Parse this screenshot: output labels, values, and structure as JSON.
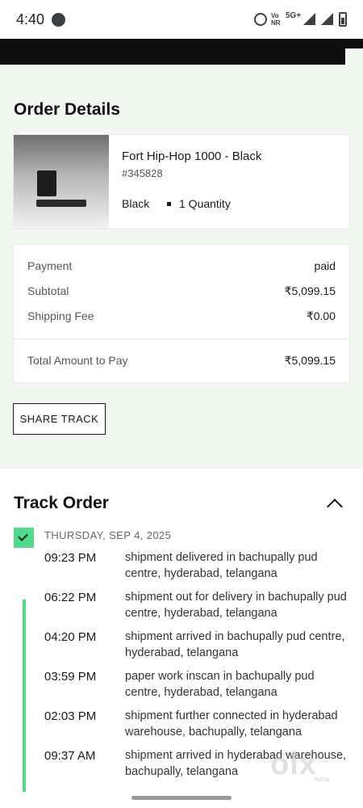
{
  "status_bar": {
    "time": "4:40",
    "network": "5G+",
    "volte": "Vo\nNR"
  },
  "order_details": {
    "title": "Order Details",
    "product": {
      "name": "Fort Hip-Hop 1000 - Black",
      "sku": "#345828",
      "color": "Black",
      "quantity": "1 Quantity"
    },
    "summary": {
      "payment_label": "Payment",
      "payment_value": "paid",
      "subtotal_label": "Subtotal",
      "subtotal_value": "₹5,099.15",
      "shipping_label": "Shipping Fee",
      "shipping_value": "₹0.00",
      "total_label": "Total Amount to Pay",
      "total_value": "₹5,099.15"
    },
    "share_label": "SHARE TRACK"
  },
  "track_order": {
    "title": "Track Order",
    "date": "THURSDAY, SEP 4, 2025",
    "events": [
      {
        "time": "09:23 PM",
        "desc": "shipment delivered in bachupally pud centre, hyderabad, telangana"
      },
      {
        "time": "06:22 PM",
        "desc": "shipment out for delivery in bachupally pud centre, hyderabad, telangana"
      },
      {
        "time": "04:20 PM",
        "desc": "shipment arrived in bachupally pud centre, hyderabad, telangana"
      },
      {
        "time": "03:59 PM",
        "desc": "paper work inscan in bachupally pud centre, hyderabad, telangana"
      },
      {
        "time": "02:03 PM",
        "desc": "shipment further connected in hyderabad warehouse, bachupally, telangana"
      },
      {
        "time": "09:37 AM",
        "desc": "shipment arrived in hyderabad warehouse, bachupally, telangana"
      }
    ]
  },
  "watermark": {
    "text": "olx",
    "sub": "INDIA"
  },
  "colors": {
    "accent_green": "#52d98b",
    "section_bg": "#f3f7f2",
    "header_black": "#0c0f0c"
  }
}
